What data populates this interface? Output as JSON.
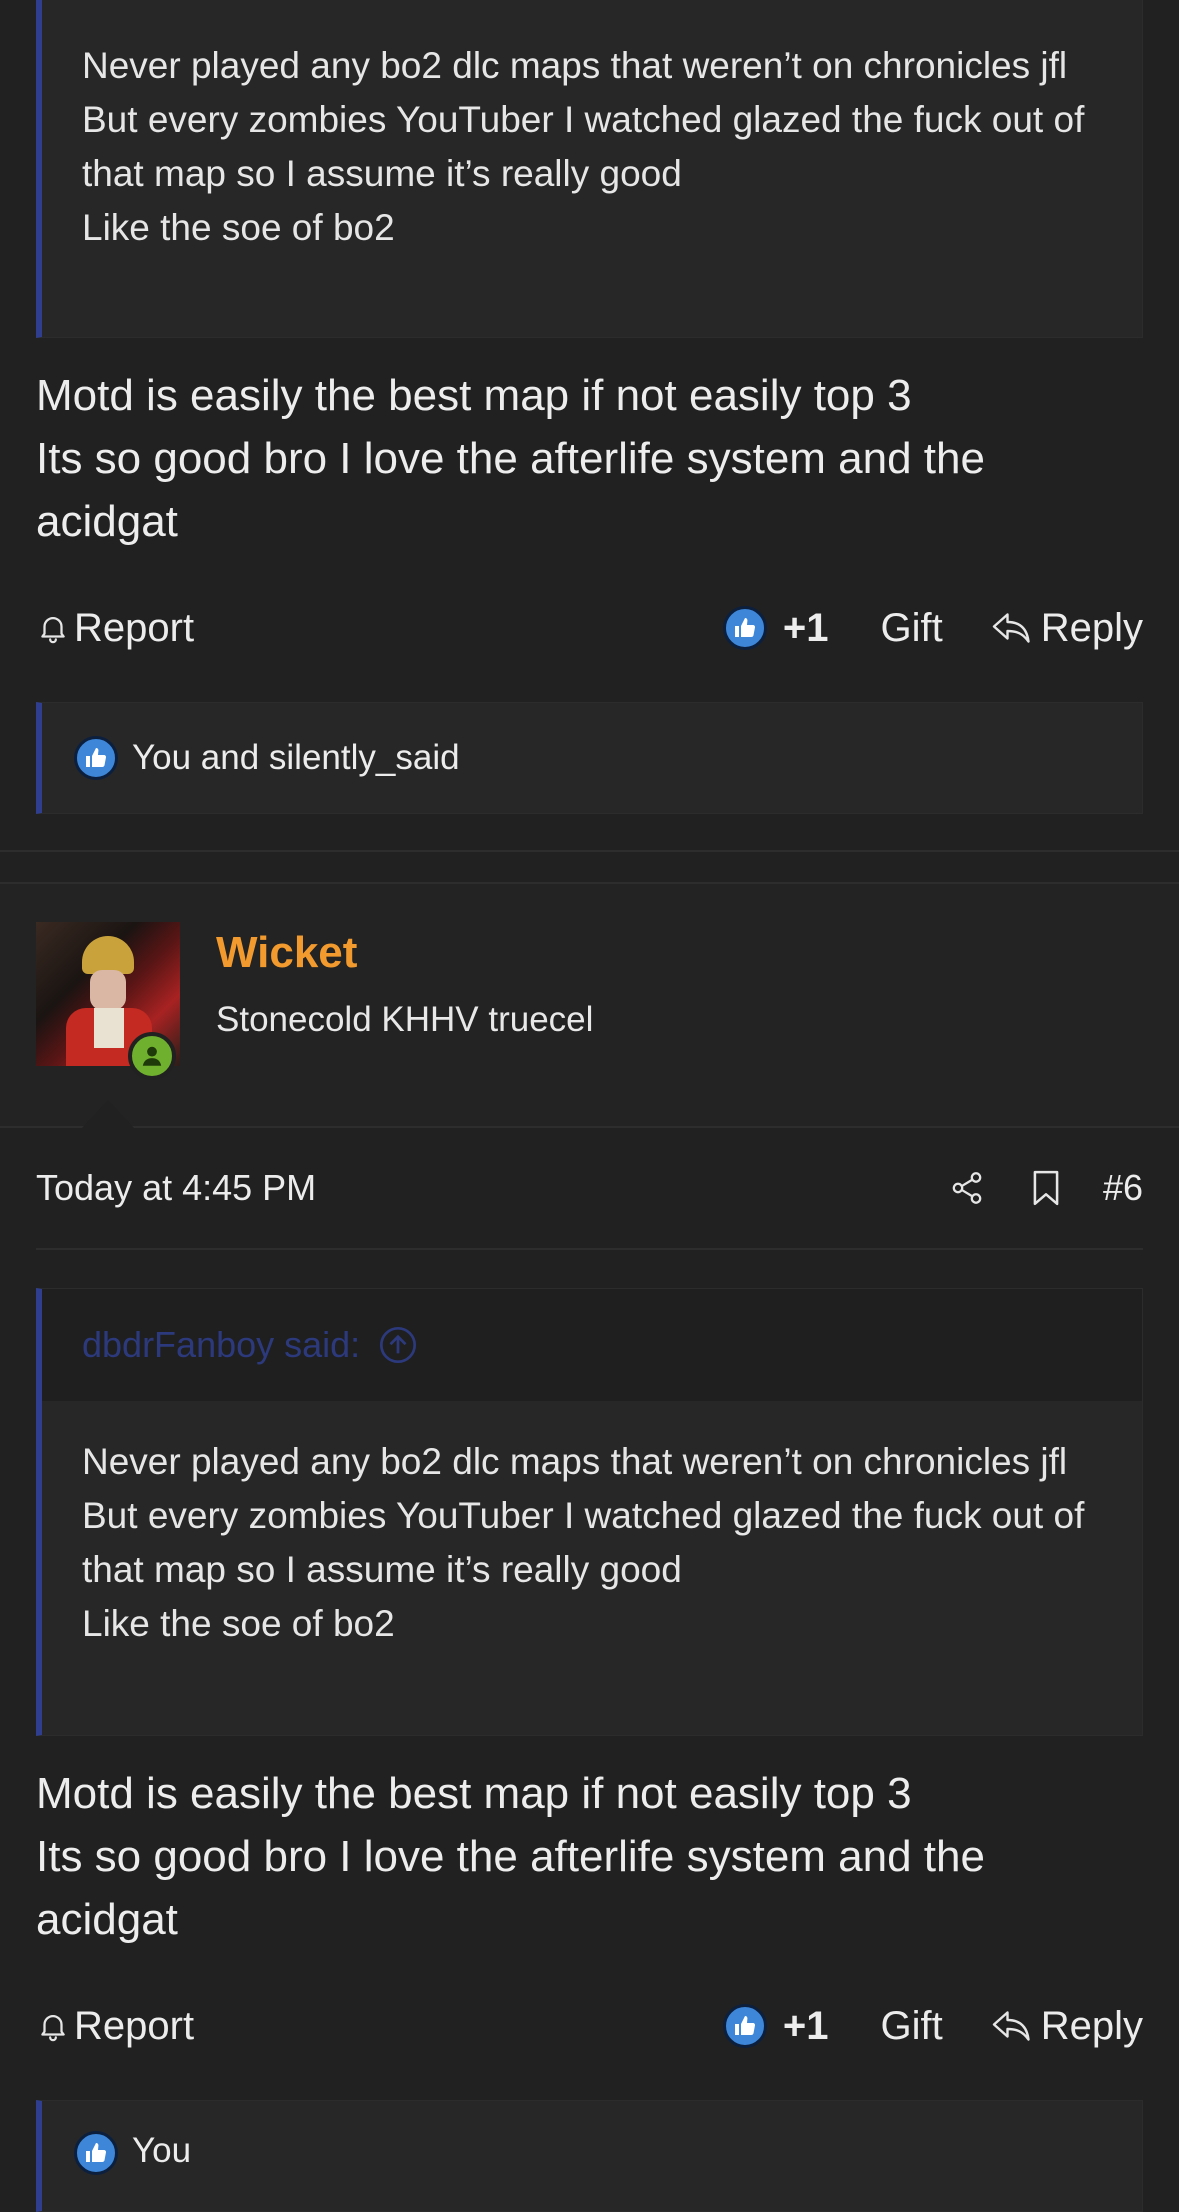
{
  "post_prev": {
    "quote": {
      "lines": [
        "Never played any bo2 dlc maps that weren’t on chronicles jfl",
        "But every zombies YouTuber I watched glazed the fuck out of that map so I assume it’s really good",
        "Like the soe of bo2"
      ]
    },
    "message": {
      "lines": [
        "Motd is easily the best map if not easily top 3",
        "Its so good bro I love the afterlife system and the acidgat"
      ]
    },
    "actions": {
      "report": "Report",
      "reaction_count": "+1",
      "gift": "Gift",
      "reply": "Reply"
    },
    "likes": "You and silently_said"
  },
  "post_6": {
    "user": {
      "name": "Wicket",
      "title": "Stonecold KHHV truecel"
    },
    "meta": {
      "date": "Today at 4:45 PM",
      "post_number": "#6"
    },
    "quote": {
      "author": "dbdrFanboy said:",
      "lines": [
        "Never played any bo2 dlc maps that weren’t on chronicles jfl",
        "But every zombies YouTuber I watched glazed the fuck out of that map so I assume it’s really good",
        "Like the soe of bo2"
      ]
    },
    "message": {
      "lines": [
        "Motd is easily the best map if not easily top 3",
        "Its so good bro I love the afterlife system and the acidgat"
      ]
    },
    "actions": {
      "report": "Report",
      "reaction_count": "+1",
      "gift": "Gift",
      "reply": "Reply"
    },
    "likes": "You"
  },
  "icons": {
    "report": "bell-icon",
    "like": "thumbs-up-icon",
    "reply": "reply-arrow-icon",
    "share": "share-icon",
    "bookmark": "bookmark-icon",
    "quote_jump": "arrow-up-circle-icon",
    "online": "user-online-icon"
  },
  "colors": {
    "background": "#212121",
    "quote_border": "#2f3e8f",
    "username": "#f29a2e",
    "like_badge": "#3d86d8",
    "online_badge": "#6fb02e",
    "quote_author": "#2c3a7d"
  }
}
